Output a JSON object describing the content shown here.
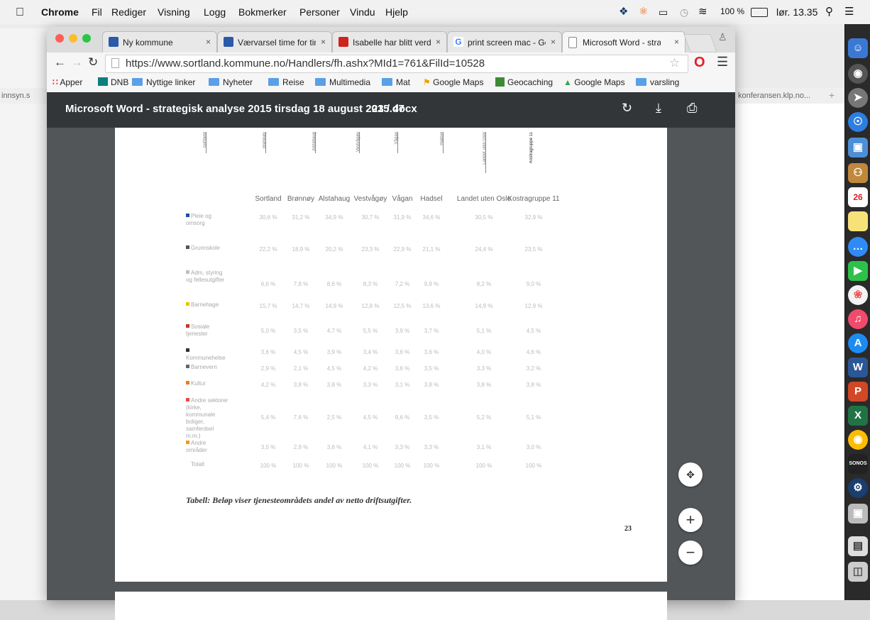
{
  "menubar": {
    "app": "Chrome",
    "items": [
      "Fil",
      "Rediger",
      "Visning",
      "Logg",
      "Bokmerker",
      "Personer",
      "Vindu",
      "Hjelp"
    ],
    "battery": "100 %",
    "clock": "lør. 13.35"
  },
  "background": {
    "left_url": "innsyn.s",
    "right_url": "konferansen.klp.no..."
  },
  "tabs": [
    {
      "label": "Ny kommune",
      "close": "×",
      "color": "#2a5aa8"
    },
    {
      "label": "Værvarsel time for tim",
      "close": "×",
      "color": "#2a5aa8"
    },
    {
      "label": "Isabelle har blitt verde",
      "close": "×",
      "color": "#d0231d"
    },
    {
      "label": "print screen mac - Goo",
      "close": "×",
      "color": "#4285f4"
    },
    {
      "label": "Microsoft Word - strat",
      "close": "×",
      "color": "#888888"
    }
  ],
  "nav": {
    "url": "https://www.sortland.kommune.no/Handlers/fh.ashx?MId1=761&FilId=10528"
  },
  "bookmarks": [
    "Apper",
    "DNB",
    "Nyttige linker",
    "Nyheter",
    "Reise",
    "Multimedia",
    "Mat",
    "Google Maps",
    "Geocaching",
    "Google Maps",
    "varsling"
  ],
  "pdf": {
    "title": "Microsoft Word - strategisk analyse 2015 tirsdag 18 august 2015.docx",
    "page_current": "23",
    "page_sep": "/",
    "page_total": "47",
    "caption": "Tabell: Beløp viser tjenesteområdets andel av netto driftsutgifter.",
    "page_number": "23",
    "top_headers": [
      "Sortland",
      "Brønnøy",
      "Alstahaug",
      "Vestvågøy",
      "Vågan",
      "Hadsel",
      "Landet uten Oslo",
      "Kostragruppe 11"
    ]
  },
  "table": {
    "columns": [
      "Sortland",
      "Brønnøy",
      "Alstahaug",
      "Vestvågøy",
      "Vågan",
      "Hadsel",
      "Landet uten Oslo",
      "Kostragruppe 11"
    ],
    "rows": [
      {
        "label": "Pleie og omsorg",
        "color": "#1f4e9c",
        "values": [
          "30,6 %",
          "31,2 %",
          "34,9 %",
          "30,7 %",
          "31,9 %",
          "34,6 %",
          "30,5 %",
          "32,9 %"
        ]
      },
      {
        "label": "Grunnskole",
        "color": "#555555",
        "values": [
          "22,2 %",
          "18,9 %",
          "20,2 %",
          "23,3 %",
          "22,9 %",
          "21,1 %",
          "24,4 %",
          "23,5 %"
        ]
      },
      {
        "label": "Adm, styring og fellesutgifter",
        "color": "#bfbfbf",
        "values": [
          "6,6 %",
          "7,8 %",
          "8,6 %",
          "8,3 %",
          "7,2 %",
          "9,9 %",
          "8,2 %",
          "9,0 %"
        ]
      },
      {
        "label": "Barnehage",
        "color": "#f2c200",
        "values": [
          "15,7 %",
          "14,7 %",
          "14,9 %",
          "12,8 %",
          "12,5 %",
          "13,6 %",
          "14,9 %",
          "12,9 %"
        ]
      },
      {
        "label": "Sosiale tjenester",
        "color": "#c0392b",
        "values": [
          "5,0 %",
          "3,5 %",
          "4,7 %",
          "5,5 %",
          "3,9 %",
          "3,7 %",
          "5,1 %",
          "4,5 %"
        ]
      },
      {
        "label": "Kommunehelse",
        "color": "#333333",
        "values": [
          "3,6 %",
          "4,5 %",
          "3,9 %",
          "3,4 %",
          "3,6 %",
          "3,6 %",
          "4,0 %",
          "4,6 %"
        ]
      },
      {
        "label": "Barnevern",
        "color": "#666666",
        "values": [
          "2,9 %",
          "2,1 %",
          "4,5 %",
          "4,2 %",
          "3,6 %",
          "3,5 %",
          "3,3 %",
          "3,2 %"
        ]
      },
      {
        "label": "Kultur",
        "color": "#e67e22",
        "values": [
          "4,2 %",
          "3,8 %",
          "3,8 %",
          "3,3 %",
          "3,1 %",
          "3,8 %",
          "3,8 %",
          "3,8 %"
        ]
      },
      {
        "label": "Andre sektorer (kirke, kommunale boliger, samferdsel m.m.)",
        "color": "#e74c3c",
        "values": [
          "5,4 %",
          "7,6 %",
          "2,5 %",
          "4,5 %",
          "9,6 %",
          "3,5 %",
          "5,2 %",
          "5,1 %"
        ]
      },
      {
        "label": "Andre områder",
        "color": "#f39c12",
        "values": [
          "3,5 %",
          "2,9 %",
          "3,6 %",
          "4,1 %",
          "3,3 %",
          "3,3 %",
          "3,1 %",
          "3,0 %"
        ]
      },
      {
        "label": "Totalt",
        "color": "#ffffff",
        "values": [
          "100 %",
          "100 %",
          "100 %",
          "100 %",
          "100 %",
          "100 %",
          "100 %",
          "100 %"
        ]
      }
    ]
  },
  "icons": [
    "apple-icon",
    "dropbox-icon",
    "wifi-icon",
    "search-icon",
    "rotate-icon",
    "download-icon",
    "print-icon",
    "zoom-in-icon",
    "zoom-out-icon",
    "fit-page-icon"
  ]
}
